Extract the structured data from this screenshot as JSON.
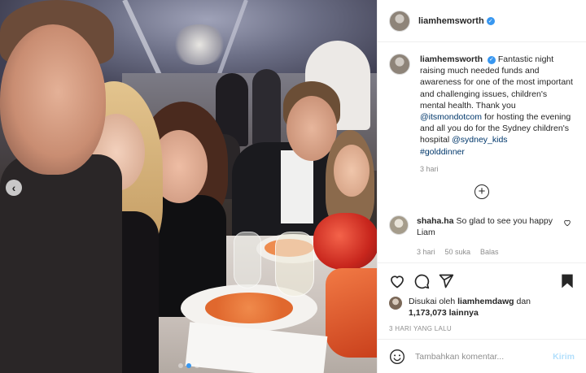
{
  "post": {
    "username": "liamhemsworth",
    "verified": true,
    "photo": {
      "carousel_prev": "‹",
      "slides": 3,
      "active_slide": 2
    },
    "caption": {
      "username": "liamhemsworth",
      "text_1": "Fantastic night raising much needed funds and awareness for one of the most important and challenging issues, children's mental health. Thank you ",
      "mention_1": "@itsmondotcom",
      "text_2": " for hosting the evening and all you do for the Sydney children's hospital ",
      "mention_2": "@sydney_kids",
      "hashtag": "#golddinner",
      "time": "3 hari"
    },
    "load_more_icon": "plus-circle-icon",
    "comments": [
      {
        "username": "shaha.ha",
        "text": "So glad to see you happy Liam",
        "time": "3 hari",
        "likes": "50 suka",
        "reply": "Balas"
      }
    ],
    "likes": {
      "prefix": "Disukai oleh ",
      "user": "liamhemdawg",
      "connector": " dan",
      "count": "1,173,073",
      "suffix": " lainnya"
    },
    "date": "3 HARI YANG LALU",
    "add_comment": {
      "placeholder": "Tambahkan komentar...",
      "post_label": "Kirim"
    }
  },
  "colors": {
    "link": "#00376b",
    "verified": "#3897f0",
    "muted": "#8e8e8e",
    "post_button": "#b2dffc"
  }
}
